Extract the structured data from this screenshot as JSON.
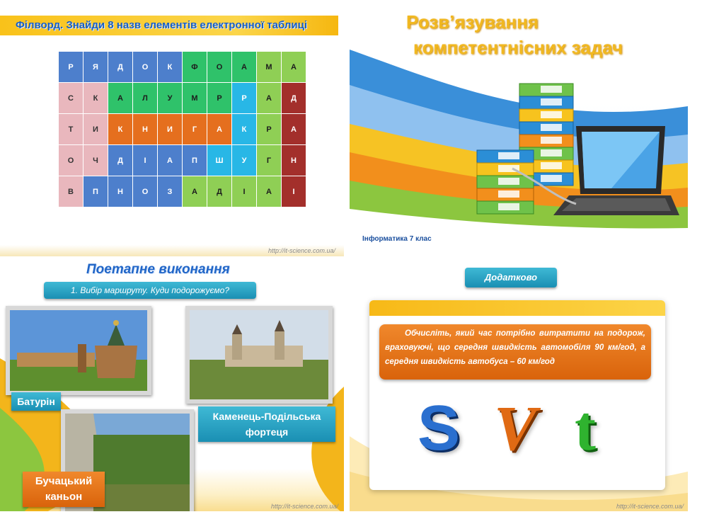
{
  "slide1": {
    "title": "Філворд. Знайди 8 назв елементів електронної таблиці",
    "grid": [
      [
        "Р",
        "Я",
        "Д",
        "О",
        "К",
        "Ф",
        "О",
        "А",
        "М",
        "А"
      ],
      [
        "С",
        "К",
        "А",
        "Л",
        "У",
        "М",
        "Р",
        "Р",
        "А",
        "Д"
      ],
      [
        "Т",
        "И",
        "К",
        "Н",
        "И",
        "Г",
        "А",
        "К",
        "Р",
        "А"
      ],
      [
        "О",
        "Ч",
        "Д",
        "І",
        "А",
        "П",
        "Ш",
        "У",
        "Г",
        "Н"
      ],
      [
        "В",
        "П",
        "Н",
        "О",
        "З",
        "А",
        "Д",
        "І",
        "А",
        "І"
      ]
    ],
    "grid_colors": [
      [
        "bl",
        "bl",
        "bl",
        "bl",
        "bl",
        "gr",
        "gr",
        "gr",
        "lg",
        "lg"
      ],
      [
        "pk",
        "pk",
        "gr",
        "gr",
        "gr",
        "gr",
        "gr",
        "cy",
        "lg",
        "dr"
      ],
      [
        "pk",
        "pk",
        "or",
        "or",
        "or",
        "or",
        "or",
        "cy",
        "lg",
        "dr"
      ],
      [
        "pk",
        "pk",
        "bl",
        "bl",
        "bl",
        "bl",
        "cy",
        "cy",
        "lg",
        "dr"
      ],
      [
        "pk",
        "bl",
        "bl",
        "bl",
        "bl",
        "lg",
        "lg",
        "lg",
        "lg",
        "dr"
      ]
    ],
    "palette": {
      "bl": "#4d7fcc",
      "gr": "#2fc26a",
      "lg": "#8fcf55",
      "pk": "#e9b7bd",
      "cy": "#28b7e6",
      "or": "#e56f1e",
      "dr": "#a32f2b"
    },
    "url": "http://it-science.com.ua/"
  },
  "slide2": {
    "title_line1": "Розв’язування",
    "title_line2": "компетентнісних задач",
    "subtitle": "Інформатика 7 клас",
    "url": "http://it-science.com.ua/"
  },
  "slide3": {
    "title": "Поетапне виконання",
    "step": "1. Вибір маршруту. Куди подорожуємо?",
    "label_baturyn": "Батурін",
    "label_kamianets_line1": "Каменець-Подільська",
    "label_kamianets_line2": "фортеця",
    "label_buchach_line1": "Бучацький",
    "label_buchach_line2": "каньон",
    "url": "http://it-science.com.ua/"
  },
  "slide4": {
    "header": "Додатково",
    "task": "Обчисліть, який час потрібно витратити на подорож, враховуючі, що середня швидкість автомобіля 90 км/год, а середня швидкість автобуса – 60 км/год",
    "letters": [
      "S",
      "V",
      "t"
    ],
    "letter_colors": [
      "#2a6fcf",
      "#e06a14",
      "#2fb32f"
    ],
    "url": "http://it-science.com.ua/"
  }
}
